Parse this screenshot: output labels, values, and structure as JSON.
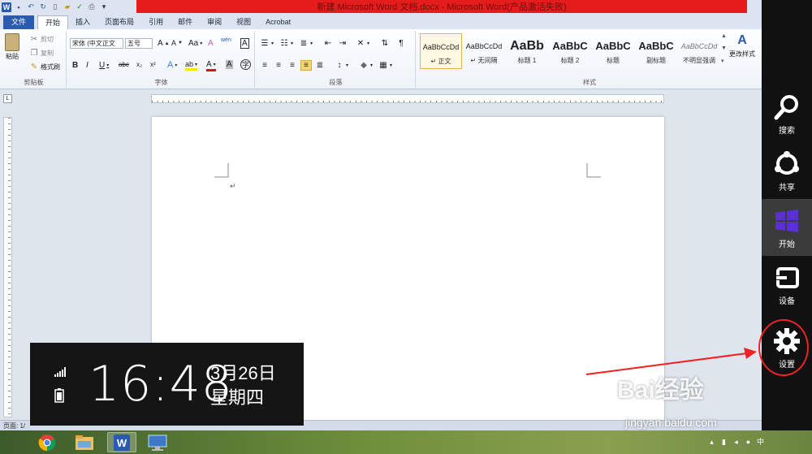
{
  "window": {
    "title": "新建 Microsoft Word 文档.docx - Microsoft Word(产品激活失败)"
  },
  "qat": {
    "icons": [
      "word-icon",
      "save-icon",
      "undo-icon",
      "redo-icon",
      "new-icon",
      "open-icon",
      "spell-check-icon",
      "print-preview-icon",
      "customize-icon"
    ]
  },
  "tabs": [
    {
      "label": "文件"
    },
    {
      "label": "开始"
    },
    {
      "label": "插入"
    },
    {
      "label": "页面布局"
    },
    {
      "label": "引用"
    },
    {
      "label": "邮件"
    },
    {
      "label": "审阅"
    },
    {
      "label": "视图"
    },
    {
      "label": "Acrobat"
    }
  ],
  "ribbon": {
    "clipboard": {
      "paste": "粘贴",
      "cut": "剪切",
      "copy": "复制",
      "format_painter": "格式刷",
      "label": "剪贴板"
    },
    "font": {
      "name": "宋体 (中文正文",
      "size": "五号",
      "grow": "A",
      "shrink": "A",
      "case": "Aa",
      "clear": "A",
      "phonetic": "wén",
      "border_char": "A",
      "bold": "B",
      "italic": "I",
      "underline": "U",
      "strike": "abc",
      "sub": "x₂",
      "sup": "x²",
      "effects": "A",
      "highlight": "ab",
      "color": "A",
      "shading": "A",
      "enclose": "字",
      "label": "字体"
    },
    "paragraph": {
      "label": "段落"
    },
    "styles": {
      "items": [
        {
          "sample": "AaBbCcDd",
          "name": "正文"
        },
        {
          "sample": "AaBbCcDd",
          "name": "无间隔"
        },
        {
          "sample": "AaBb",
          "name": "标题 1"
        },
        {
          "sample": "AaBbC",
          "name": "标题 2"
        },
        {
          "sample": "AaBbC",
          "name": "标题"
        },
        {
          "sample": "AaBbC",
          "name": "副标题"
        },
        {
          "sample": "AaBbCcDd",
          "name": "不明显强调"
        }
      ],
      "change_styles": "更改样式",
      "label": "样式"
    }
  },
  "ruler": {
    "tab_selector": "L"
  },
  "statusbar": {
    "page": "页面: 1/",
    "words": "",
    "lang": ""
  },
  "clock": {
    "time": "16:48",
    "date": "3月26日",
    "weekday": "星期四"
  },
  "charms": [
    {
      "label": "搜索",
      "icon": "search-icon"
    },
    {
      "label": "共享",
      "icon": "share-icon"
    },
    {
      "label": "开始",
      "icon": "windows-start-icon"
    },
    {
      "label": "设备",
      "icon": "devices-icon"
    },
    {
      "label": "设置",
      "icon": "settings-gear-icon"
    }
  ],
  "taskbar": {
    "apps": [
      "chrome-icon",
      "file-explorer-icon",
      "word-icon",
      "remote-desktop-icon"
    ],
    "tray_time": ""
  },
  "watermark": {
    "logo": "Bai经验",
    "url": "jingyan.baidu.com"
  },
  "colors": {
    "accent_blue": "#2a5bb0",
    "title_red": "#e41c1c",
    "charms_bg": "#111111",
    "annotation_red": "#e22222"
  }
}
